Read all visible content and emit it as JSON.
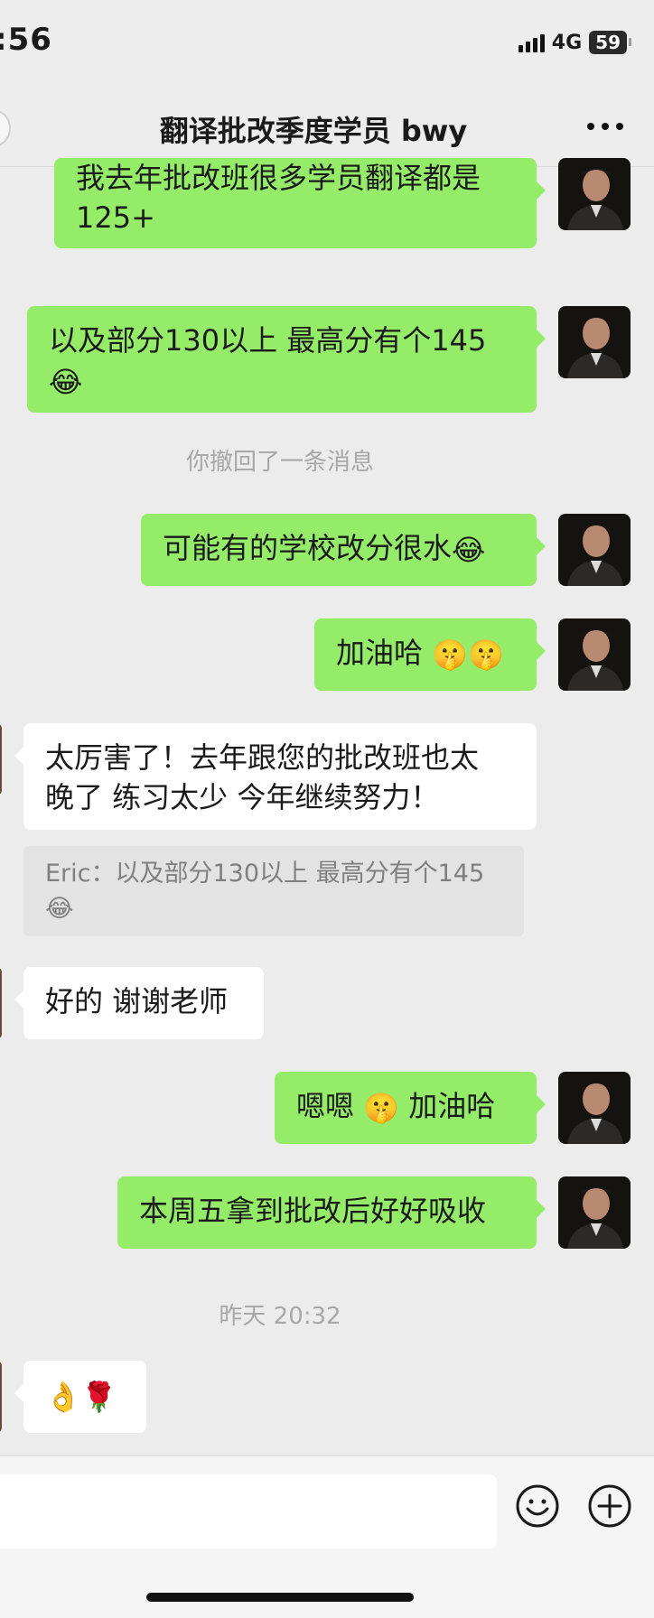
{
  "status_bar": {
    "time": ":56",
    "network": "4G",
    "battery": "59"
  },
  "header": {
    "title": "翻译批改季度学员 bwy",
    "more_icon": "more-dots-icon"
  },
  "messages": [
    {
      "side": "me",
      "text_line1": "我去年批改班很多学员翻译都是",
      "text_line2": "125+"
    },
    {
      "side": "me",
      "text_line1": "以及部分130以上 最高分有个145",
      "emoji": "😂"
    },
    {
      "system": "你撤回了一条消息"
    },
    {
      "side": "me",
      "text": "可能有的学校改分很水",
      "emoji": "😂"
    },
    {
      "side": "me",
      "text": "加油哈",
      "emoji": "🤫🤫"
    },
    {
      "side": "them",
      "text_line1": "太厉害了！去年跟您的批改班也太",
      "text_line2": "晚了 练习太少 今年继续努力！",
      "quote": "Eric：以及部分130以上 最高分有个145",
      "quote_emoji": "😂"
    },
    {
      "side": "them",
      "text": "好的 谢谢老师"
    },
    {
      "side": "me",
      "text_before": "嗯嗯",
      "emoji": "🤫",
      "text_after": "加油哈"
    },
    {
      "side": "me",
      "text": "本周五拿到批改后好好吸收"
    },
    {
      "system": "昨天 20:32"
    },
    {
      "side": "them",
      "emoji": "👌🌹"
    }
  ],
  "input_bar": {
    "placeholder": "",
    "emoji_icon": "emoji-face-icon",
    "add_icon": "plus-circle-icon"
  },
  "colors": {
    "my_bubble": "#95ec69",
    "their_bubble": "#ffffff",
    "background": "#ececec"
  }
}
